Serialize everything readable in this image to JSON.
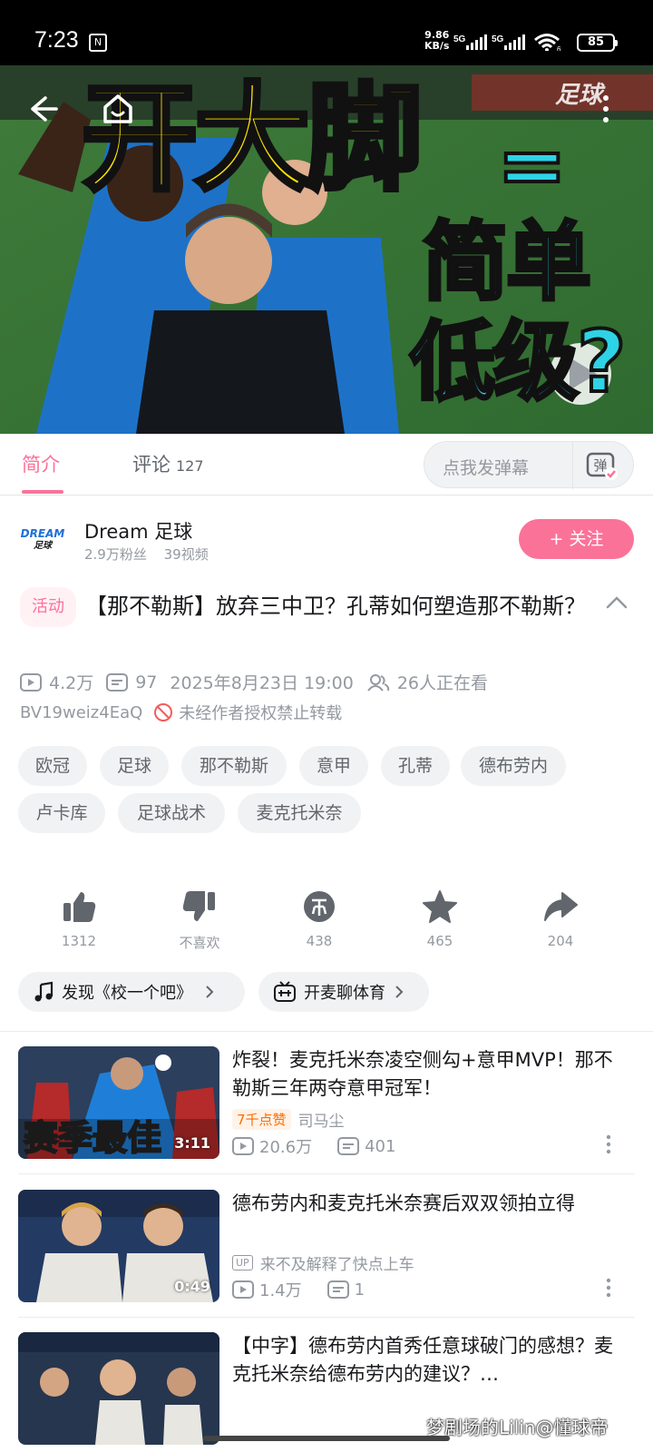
{
  "status_bar": {
    "time": "7:23",
    "net_speed_value": "9.86",
    "net_speed_unit": "KB/s",
    "signal1": "5G",
    "signal2": "5G",
    "wifi_level": "6",
    "battery": "85"
  },
  "video": {
    "title_line1": "开大脚",
    "title_eq": "=",
    "title_line2": "简单",
    "title_line3": "低级?",
    "watermark": "足球"
  },
  "tabs": {
    "intro": "简介",
    "comments": "评论",
    "comments_count": "127",
    "danmaku_placeholder": "点我发弹幕",
    "danmaku_icon_text": "弹"
  },
  "uploader": {
    "logo_text1": "DREAM",
    "logo_text2": "足球",
    "name": "Dream 足球",
    "fans": "2.9万粉丝",
    "videos": "39视频",
    "follow_label": "+ 关注"
  },
  "video_info": {
    "badge": "活动",
    "title": "【那不勒斯】放弃三中卫？孔蒂如何塑造那不勒斯？",
    "views": "4.2万",
    "danmaku_count": "97",
    "date": "2025年8月23日 19:00",
    "watching": "26人正在看",
    "bvid": "BV19weiz4EaQ",
    "copyright": "未经作者授权禁止转载"
  },
  "tags": [
    "欧冠",
    "足球",
    "那不勒斯",
    "意甲",
    "孔蒂",
    "德布劳内",
    "卢卡库",
    "足球战术",
    "麦克托米奈"
  ],
  "actions": {
    "like": "1312",
    "dislike": "不喜欢",
    "coin": "438",
    "favorite": "465",
    "share": "204"
  },
  "chips": {
    "music": "发现《校一个吧》",
    "chat": "开麦聊体育"
  },
  "related": [
    {
      "title": "炸裂！麦克托米奈凌空侧勾+意甲MVP！那不勒斯三年两夺意甲冠军！",
      "badge": "7千点赞",
      "author": "司马尘",
      "views": "20.6万",
      "danmaku": "401",
      "duration": "3:11",
      "thumb_text": "赛季最佳"
    },
    {
      "title": "德布劳内和麦克托米奈赛后双双领拍立得",
      "author": "来不及解释了快点上车",
      "up_tag": "UP",
      "views": "1.4万",
      "danmaku": "1",
      "duration": "0:49"
    },
    {
      "title": "【中字】德布劳内首秀任意球破门的感想？麦克托米奈给德布劳内的建议？…"
    }
  ],
  "overlay_watermark": "梦剧场的Lilin@懂球帝",
  "colors": {
    "accent_pink": "#fb7299",
    "secondary_text": "#9499a0",
    "tag_bg": "#f1f2f3"
  }
}
